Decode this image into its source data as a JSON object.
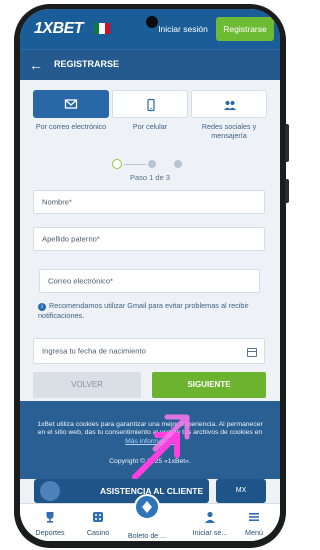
{
  "header": {
    "logo": "1XBET",
    "login_label": "Iniciar sesión",
    "register_label": "Registrarse"
  },
  "section": {
    "title": "REGISTRARSE"
  },
  "methods": [
    {
      "label": "Por correo electrónico",
      "icon": "envelope-icon",
      "active": true
    },
    {
      "label": "Por celular",
      "icon": "mobile-phone-icon",
      "active": false
    },
    {
      "label": "Redes sociales y mensajería",
      "icon": "people-icon",
      "active": false
    }
  ],
  "step": {
    "text": "Paso 1 de 3",
    "current": 1,
    "total": 3
  },
  "form": {
    "name_placeholder": "Nombre*",
    "surname_placeholder": "Apellido paterno*",
    "email_placeholder": "Correo electrónico*",
    "gmail_notice": "Recomendamos utilizar Gmail para evitar problemas al recibir notificaciones.",
    "birthdate_placeholder": "Ingresa tu fecha de nacimiento",
    "back_label": "VOLVER",
    "next_label": "SIGUIENTE"
  },
  "cookie": {
    "text_part1": "1xBet utiliza cookies para garantizar una mejor experiencia. Al permanecer en el sitio web, das tu consentimiento al uso de tus archivos de cookies en",
    "link_text": "Más información",
    "copyright": "Copyright © 2025 «1xBet»."
  },
  "assist": {
    "label": "ASISTENCIA AL CLIENTE",
    "lang": "MX"
  },
  "nav": [
    {
      "label": "Deportes",
      "icon": "trophy-icon"
    },
    {
      "label": "Casino",
      "icon": "casino-icon"
    },
    {
      "label": "Boleto de ...",
      "icon": "bet-slip-icon"
    },
    {
      "label": "Iniciar se...",
      "icon": "user-icon"
    },
    {
      "label": "Menú",
      "icon": "menu-icon"
    }
  ],
  "colors": {
    "brand_blue": "#1a5d98",
    "accent_green": "#6cb430",
    "overlay_pink": "#ff2bd6"
  }
}
